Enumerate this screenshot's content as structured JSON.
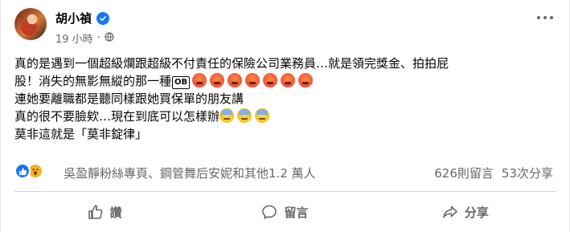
{
  "post": {
    "author": "胡小禎",
    "time": "19 小時",
    "visibility_icon": "globe-icon",
    "body_lines": [
      "真的是遇到一個超級爛跟超級不付責任的保險公司業務員…就是領完獎金、拍拍屁",
      "股！消失的無影無縱的那一種",
      "連她要離職都是聽同樣跟她買保單的朋友講",
      "真的很不要臉欸…現在到底可以怎樣辦",
      "莫非這就是「莫非錠律」"
    ],
    "ob_badge": "OB",
    "emoji_angry_count": 7,
    "emoji_sweat_count": 3
  },
  "reactions": {
    "icons": [
      "like-icon",
      "wow-icon"
    ],
    "text": "吳盈靜粉絲專頁、鋼管舞后安妮和其他1.2 萬人"
  },
  "counts": {
    "comments": "626則留言",
    "shares": "53次分享"
  },
  "actions": {
    "like": "讚",
    "comment": "留言",
    "share": "分享"
  },
  "colors": {
    "accent": "#1877f2",
    "secondary_text": "#65676b",
    "primary_text": "#050505"
  }
}
